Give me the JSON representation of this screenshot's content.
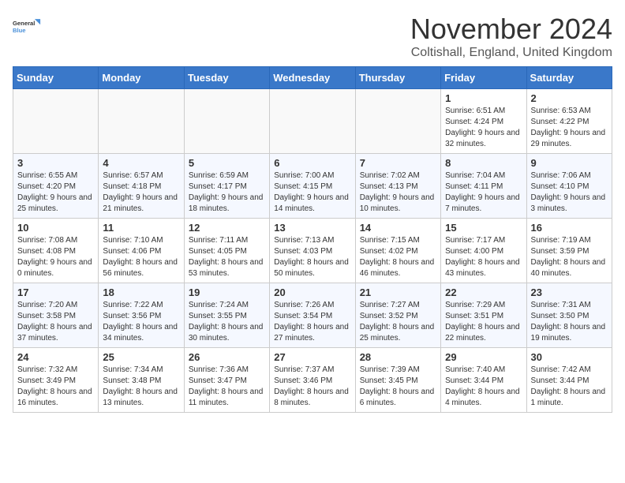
{
  "logo": {
    "line1": "General",
    "line2": "Blue"
  },
  "title": "November 2024",
  "location": "Coltishall, England, United Kingdom",
  "days_header": [
    "Sunday",
    "Monday",
    "Tuesday",
    "Wednesday",
    "Thursday",
    "Friday",
    "Saturday"
  ],
  "weeks": [
    [
      {
        "day": "",
        "empty": true
      },
      {
        "day": "",
        "empty": true
      },
      {
        "day": "",
        "empty": true
      },
      {
        "day": "",
        "empty": true
      },
      {
        "day": "",
        "empty": true
      },
      {
        "day": "1",
        "sunrise": "6:51 AM",
        "sunset": "4:24 PM",
        "daylight": "9 hours and 32 minutes."
      },
      {
        "day": "2",
        "sunrise": "6:53 AM",
        "sunset": "4:22 PM",
        "daylight": "9 hours and 29 minutes."
      }
    ],
    [
      {
        "day": "3",
        "sunrise": "6:55 AM",
        "sunset": "4:20 PM",
        "daylight": "9 hours and 25 minutes."
      },
      {
        "day": "4",
        "sunrise": "6:57 AM",
        "sunset": "4:18 PM",
        "daylight": "9 hours and 21 minutes."
      },
      {
        "day": "5",
        "sunrise": "6:59 AM",
        "sunset": "4:17 PM",
        "daylight": "9 hours and 18 minutes."
      },
      {
        "day": "6",
        "sunrise": "7:00 AM",
        "sunset": "4:15 PM",
        "daylight": "9 hours and 14 minutes."
      },
      {
        "day": "7",
        "sunrise": "7:02 AM",
        "sunset": "4:13 PM",
        "daylight": "9 hours and 10 minutes."
      },
      {
        "day": "8",
        "sunrise": "7:04 AM",
        "sunset": "4:11 PM",
        "daylight": "9 hours and 7 minutes."
      },
      {
        "day": "9",
        "sunrise": "7:06 AM",
        "sunset": "4:10 PM",
        "daylight": "9 hours and 3 minutes."
      }
    ],
    [
      {
        "day": "10",
        "sunrise": "7:08 AM",
        "sunset": "4:08 PM",
        "daylight": "9 hours and 0 minutes."
      },
      {
        "day": "11",
        "sunrise": "7:10 AM",
        "sunset": "4:06 PM",
        "daylight": "8 hours and 56 minutes."
      },
      {
        "day": "12",
        "sunrise": "7:11 AM",
        "sunset": "4:05 PM",
        "daylight": "8 hours and 53 minutes."
      },
      {
        "day": "13",
        "sunrise": "7:13 AM",
        "sunset": "4:03 PM",
        "daylight": "8 hours and 50 minutes."
      },
      {
        "day": "14",
        "sunrise": "7:15 AM",
        "sunset": "4:02 PM",
        "daylight": "8 hours and 46 minutes."
      },
      {
        "day": "15",
        "sunrise": "7:17 AM",
        "sunset": "4:00 PM",
        "daylight": "8 hours and 43 minutes."
      },
      {
        "day": "16",
        "sunrise": "7:19 AM",
        "sunset": "3:59 PM",
        "daylight": "8 hours and 40 minutes."
      }
    ],
    [
      {
        "day": "17",
        "sunrise": "7:20 AM",
        "sunset": "3:58 PM",
        "daylight": "8 hours and 37 minutes."
      },
      {
        "day": "18",
        "sunrise": "7:22 AM",
        "sunset": "3:56 PM",
        "daylight": "8 hours and 34 minutes."
      },
      {
        "day": "19",
        "sunrise": "7:24 AM",
        "sunset": "3:55 PM",
        "daylight": "8 hours and 30 minutes."
      },
      {
        "day": "20",
        "sunrise": "7:26 AM",
        "sunset": "3:54 PM",
        "daylight": "8 hours and 27 minutes."
      },
      {
        "day": "21",
        "sunrise": "7:27 AM",
        "sunset": "3:52 PM",
        "daylight": "8 hours and 25 minutes."
      },
      {
        "day": "22",
        "sunrise": "7:29 AM",
        "sunset": "3:51 PM",
        "daylight": "8 hours and 22 minutes."
      },
      {
        "day": "23",
        "sunrise": "7:31 AM",
        "sunset": "3:50 PM",
        "daylight": "8 hours and 19 minutes."
      }
    ],
    [
      {
        "day": "24",
        "sunrise": "7:32 AM",
        "sunset": "3:49 PM",
        "daylight": "8 hours and 16 minutes."
      },
      {
        "day": "25",
        "sunrise": "7:34 AM",
        "sunset": "3:48 PM",
        "daylight": "8 hours and 13 minutes."
      },
      {
        "day": "26",
        "sunrise": "7:36 AM",
        "sunset": "3:47 PM",
        "daylight": "8 hours and 11 minutes."
      },
      {
        "day": "27",
        "sunrise": "7:37 AM",
        "sunset": "3:46 PM",
        "daylight": "8 hours and 8 minutes."
      },
      {
        "day": "28",
        "sunrise": "7:39 AM",
        "sunset": "3:45 PM",
        "daylight": "8 hours and 6 minutes."
      },
      {
        "day": "29",
        "sunrise": "7:40 AM",
        "sunset": "3:44 PM",
        "daylight": "8 hours and 4 minutes."
      },
      {
        "day": "30",
        "sunrise": "7:42 AM",
        "sunset": "3:44 PM",
        "daylight": "8 hours and 1 minute."
      }
    ]
  ]
}
